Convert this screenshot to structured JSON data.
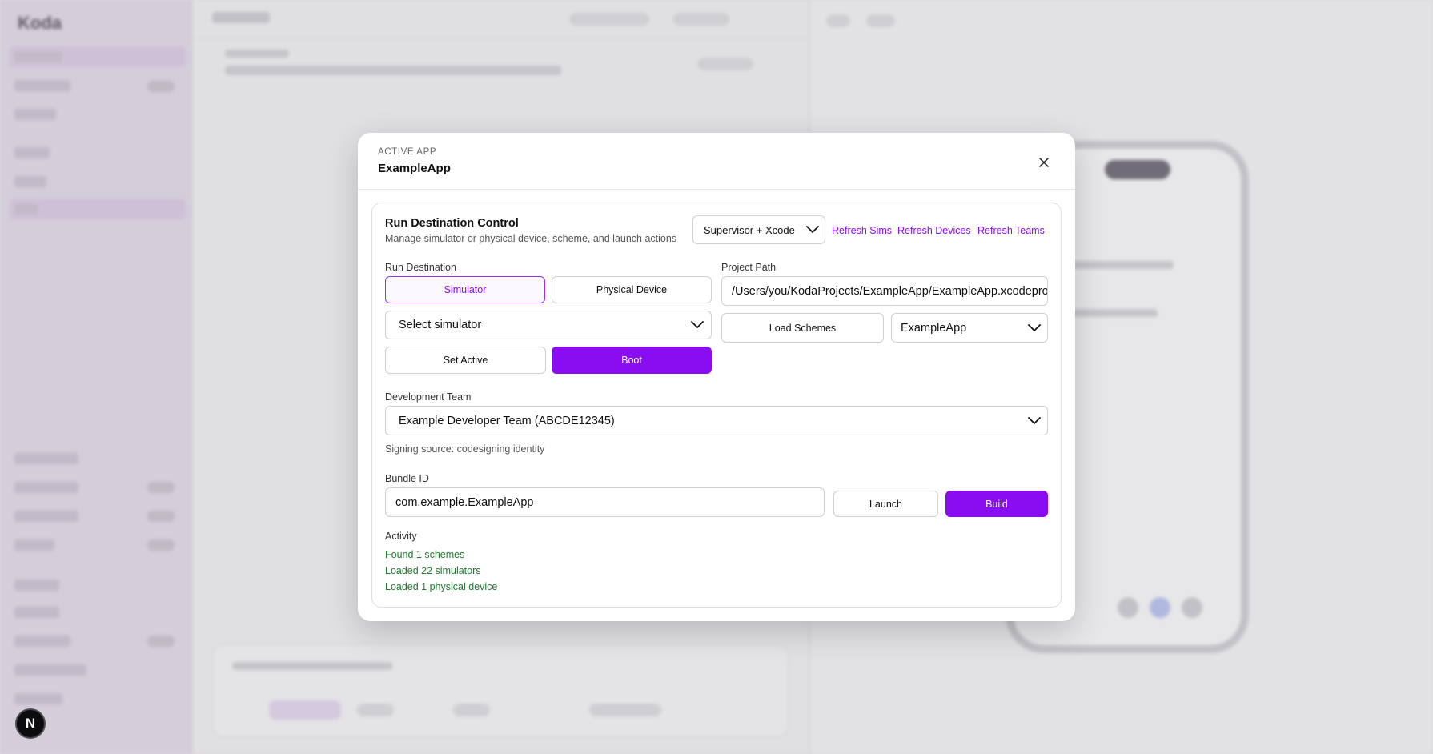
{
  "background": {
    "logo": "Koda"
  },
  "next_badge": "N",
  "modal": {
    "label": "ACTIVE APP",
    "title": "ExampleApp",
    "card": {
      "title": "Run Destination Control",
      "subtitle": "Manage simulator or physical device, scheme, and launch actions",
      "mode_select": "Supervisor + Xcode",
      "links": [
        "Refresh Sims",
        "Refresh Devices",
        "Refresh Teams"
      ],
      "run_destination": {
        "label": "Run Destination",
        "simulator_tab": "Simulator",
        "device_tab": "Physical Device",
        "simulator_select": "Select simulator",
        "set_active": "Set Active",
        "boot": "Boot"
      },
      "project": {
        "label": "Project Path",
        "path": "/Users/you/KodaProjects/ExampleApp/ExampleApp.xcodeproj",
        "load_schemes": "Load Schemes",
        "scheme_select": "ExampleApp"
      },
      "team": {
        "label": "Development Team",
        "value": "Example Developer Team (ABCDE12345)",
        "signing_hint": "Signing source: codesigning identity"
      },
      "bundle": {
        "label": "Bundle ID",
        "value": "com.example.ExampleApp",
        "launch": "Launch",
        "build": "Build"
      },
      "activity": {
        "label": "Activity",
        "lines": [
          "Found 1 schemes",
          "Loaded 22 simulators",
          "Loaded 1 physical device"
        ]
      }
    }
  },
  "colors": {
    "accent": "#8a0cf0",
    "success_text": "#1f7a2f"
  }
}
